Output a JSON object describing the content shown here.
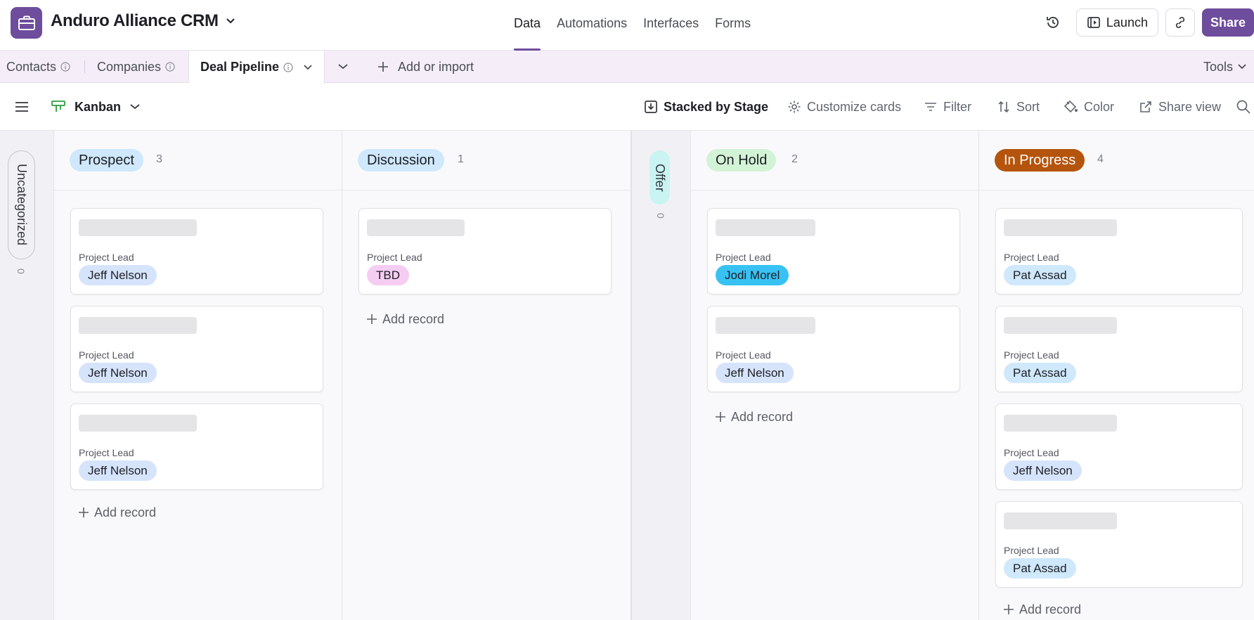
{
  "header": {
    "app_title": "Anduro Alliance CRM",
    "nav": [
      "Data",
      "Automations",
      "Interfaces",
      "Forms"
    ],
    "launch_label": "Launch",
    "share_label": "Share",
    "accent_color": "#6e4d9c"
  },
  "tabs": {
    "contacts": "Contacts",
    "companies": "Companies",
    "deal_pipeline": "Deal Pipeline",
    "add_import": "Add or import",
    "tools": "Tools"
  },
  "toolbar": {
    "view_name": "Kanban",
    "stacked": "Stacked by Stage",
    "customize": "Customize cards",
    "filter": "Filter",
    "sort": "Sort",
    "color": "Color",
    "share_view": "Share view"
  },
  "board": {
    "uncategorized": {
      "label": "Uncategorized",
      "count": "0"
    },
    "offer": {
      "label": "Offer",
      "count": "0"
    },
    "field_label": "Project Lead",
    "add_record": "Add record",
    "columns": [
      {
        "name": "Prospect",
        "count": "3",
        "color": "#cfe8fb",
        "cards": [
          {
            "person": "Jeff Nelson"
          },
          {
            "person": "Jeff Nelson"
          },
          {
            "person": "Jeff Nelson"
          }
        ]
      },
      {
        "name": "Discussion",
        "count": "1",
        "color": "#cfe8fb",
        "cards": [
          {
            "person": "TBD"
          }
        ]
      },
      {
        "name": "On Hold",
        "count": "2",
        "color": "#d3f3d6",
        "cards": [
          {
            "person": "Jodi Morel"
          },
          {
            "person": "Jeff Nelson"
          }
        ]
      },
      {
        "name": "In Progress",
        "count": "4",
        "color": "#b5540d",
        "cards": [
          {
            "person": "Pat Assad"
          },
          {
            "person": "Pat Assad"
          },
          {
            "person": "Jeff Nelson"
          },
          {
            "person": "Pat Assad"
          }
        ]
      }
    ]
  }
}
